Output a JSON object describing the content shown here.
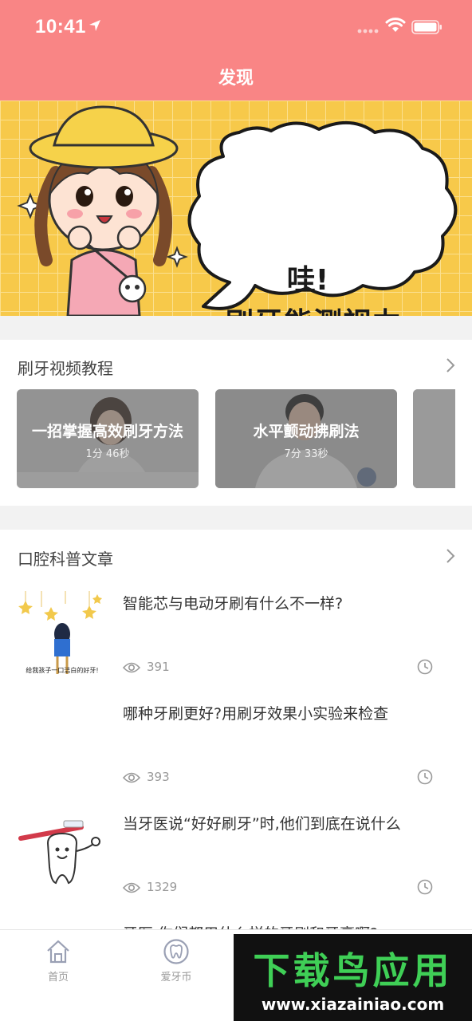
{
  "status_bar": {
    "time": "10:41"
  },
  "header": {
    "title": "发现"
  },
  "banner": {
    "line1": "哇!",
    "line2": "刷牙能测视力"
  },
  "video_section": {
    "title": "刷牙视频教程",
    "videos": [
      {
        "title": "一招掌握高效刷牙方法",
        "duration": "1分 46秒"
      },
      {
        "title": "水平颤动拂刷法",
        "duration": "7分 33秒"
      }
    ]
  },
  "article_section": {
    "title": "口腔科普文章",
    "articles": [
      {
        "title": "智能芯与电动牙刷有什么不一样?",
        "views": "391",
        "thumb_caption": "给我孩子一口洁白的好牙!"
      },
      {
        "title": "哪种牙刷更好?用刷牙效果小实验来检查",
        "views": "393"
      },
      {
        "title": "当牙医说“好好刷牙”时,他们到底在说什么",
        "views": "1329"
      },
      {
        "title": "牙医,你们都用什么样的牙刷和牙膏啊?"
      }
    ]
  },
  "tabbar": {
    "items": [
      {
        "label": "首页"
      },
      {
        "label": "爱牙币"
      }
    ]
  },
  "watermark": {
    "text": "下载鸟应用",
    "url": "www.xiazainiao.com"
  },
  "colors": {
    "header": "#f98585",
    "banner_bg": "#f7c94a",
    "watermark_green": "#3fcf56"
  }
}
